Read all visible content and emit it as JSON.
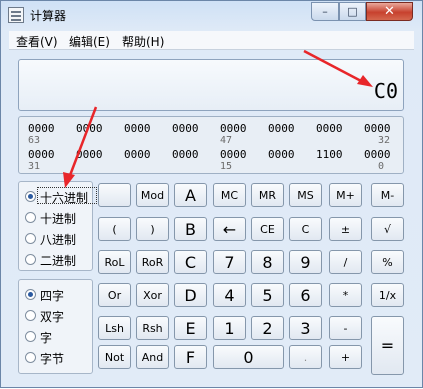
{
  "window": {
    "title": "计算器",
    "controls": {
      "minimize": "–",
      "maximize": "□",
      "close": "✕"
    }
  },
  "menu": [
    "查看(V)",
    "编辑(E)",
    "帮助(H)"
  ],
  "display": {
    "value": "C0"
  },
  "bits": {
    "groups": [
      [
        "0000",
        "0000",
        "0000",
        "0000",
        "0000",
        "0000",
        "0000",
        "0000"
      ],
      [
        "0000",
        "0000",
        "0000",
        "0000",
        "0000",
        "0000",
        "1100",
        "0000"
      ]
    ],
    "indices": [
      [
        "63",
        "47",
        "32"
      ],
      [
        "31",
        "15",
        "0"
      ]
    ]
  },
  "radix": [
    {
      "label": "十六进制",
      "selected": true
    },
    {
      "label": "十进制",
      "selected": false
    },
    {
      "label": "八进制",
      "selected": false
    },
    {
      "label": "二进制",
      "selected": false
    }
  ],
  "word_size": [
    {
      "label": "四字",
      "selected": true
    },
    {
      "label": "双字",
      "selected": false
    },
    {
      "label": "字",
      "selected": false
    },
    {
      "label": "字节",
      "selected": false
    }
  ],
  "keys": [
    [
      "",
      "Mod",
      "A",
      "MC",
      "MR",
      "MS",
      "M+",
      "M-"
    ],
    [
      "(",
      ")",
      "B",
      "←",
      "CE",
      "C",
      "±",
      "√"
    ],
    [
      "RoL",
      "RoR",
      "C",
      "7",
      "8",
      "9",
      "/",
      "%"
    ],
    [
      "Or",
      "Xor",
      "D",
      "4",
      "5",
      "6",
      "*",
      "1/x"
    ],
    [
      "Lsh",
      "Rsh",
      "E",
      "1",
      "2",
      "3",
      "-",
      "="
    ],
    [
      "Not",
      "And",
      "F",
      "0",
      ".",
      "+"
    ]
  ],
  "colors": {
    "arrow": "#e8262a",
    "selected_radio": "#2b5aa0"
  }
}
